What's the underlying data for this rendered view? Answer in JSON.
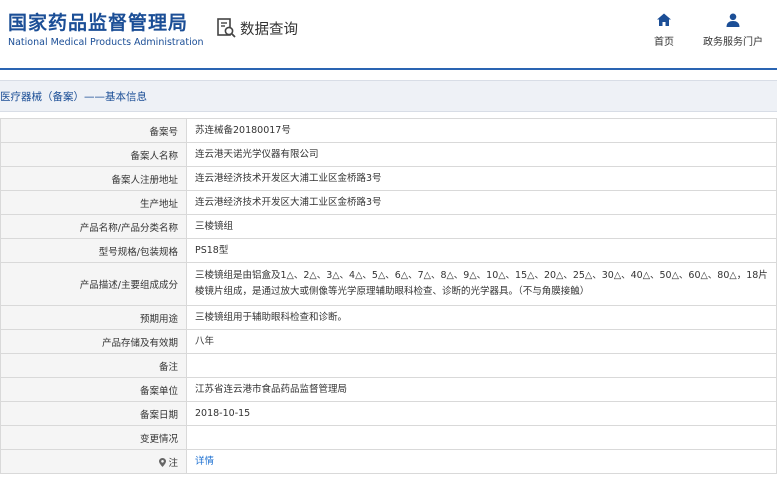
{
  "header": {
    "logo_cn": "国家药品监督管理局",
    "logo_en": "National Medical Products Administration",
    "query_title": "数据查询",
    "nav": [
      {
        "label": "首页",
        "icon": "home-icon"
      },
      {
        "label": "政务服务门户",
        "icon": "user-icon"
      }
    ]
  },
  "section": {
    "title": "医疗器械（备案）——基本信息"
  },
  "rows": [
    {
      "label": "备案号",
      "value": "苏连械备20180017号"
    },
    {
      "label": "备案人名称",
      "value": "连云港天诺光学仪器有限公司"
    },
    {
      "label": "备案人注册地址",
      "value": "连云港经济技术开发区大浦工业区金桥路3号"
    },
    {
      "label": "生产地址",
      "value": "连云港经济技术开发区大浦工业区金桥路3号"
    },
    {
      "label": "产品名称/产品分类名称",
      "value": "三棱镜组"
    },
    {
      "label": "型号规格/包装规格",
      "value": "PS18型"
    },
    {
      "label": "产品描述/主要组成成分",
      "value": "三棱镜组是由铝盒及1△、2△、3△、4△、5△、6△、7△、8△、9△、10△、15△、20△、25△、30△、40△、50△、60△、80△，18片棱镜片组成，是通过放大或侧像等光学原理辅助眼科检查、诊断的光学器具。（不与角膜接触）"
    },
    {
      "label": "预期用途",
      "value": "三棱镜组用于辅助眼科检查和诊断。"
    },
    {
      "label": "产品存储及有效期",
      "value": "八年"
    },
    {
      "label": "备注",
      "value": ""
    },
    {
      "label": "备案单位",
      "value": "江苏省连云港市食品药品监督管理局"
    },
    {
      "label": "备案日期",
      "value": "2018-10-15"
    },
    {
      "label": "变更情况",
      "value": ""
    },
    {
      "label": "注",
      "value": "详情",
      "icon": "location-pin-icon"
    }
  ],
  "colors": {
    "brand": "#1b4e96",
    "link": "#1b6fd1",
    "label_bg": "#f5f5f5",
    "border": "#d9d9d9"
  }
}
